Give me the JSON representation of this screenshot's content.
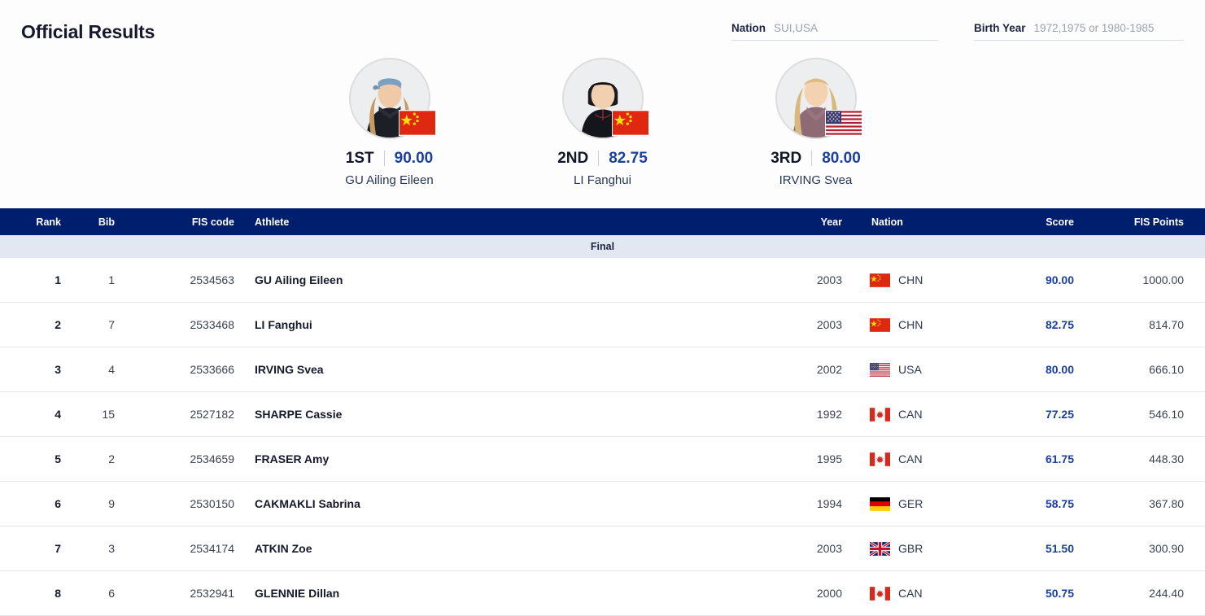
{
  "header": {
    "title": "Official Results",
    "filters": [
      {
        "name": "nation",
        "label": "Nation",
        "value": "",
        "placeholder": "SUI,USA"
      },
      {
        "name": "birth-year",
        "label": "Birth Year",
        "value": "",
        "placeholder": "1972,1975 or 1980-1985"
      }
    ]
  },
  "podium": [
    {
      "rank_label": "1ST",
      "score": "90.00",
      "name": "GU Ailing Eileen",
      "flag": "CHN",
      "avatar": "female-cap-blond"
    },
    {
      "rank_label": "2ND",
      "score": "82.75",
      "name": "LI Fanghui",
      "flag": "CHN",
      "avatar": "female-dark-hair"
    },
    {
      "rank_label": "3RD",
      "score": "80.00",
      "name": "IRVING Svea",
      "flag": "USA",
      "avatar": "female-blond-jacket"
    }
  ],
  "table": {
    "columns": [
      "Rank",
      "Bib",
      "FIS code",
      "Athlete",
      "Year",
      "Nation",
      "Score",
      "FIS Points"
    ],
    "section_label": "Final",
    "rows": [
      {
        "rank": "1",
        "bib": "1",
        "fis_code": "2534563",
        "athlete": "GU Ailing Eileen",
        "year": "2003",
        "nation": "CHN",
        "score": "90.00",
        "fis_points": "1000.00"
      },
      {
        "rank": "2",
        "bib": "7",
        "fis_code": "2533468",
        "athlete": "LI Fanghui",
        "year": "2003",
        "nation": "CHN",
        "score": "82.75",
        "fis_points": "814.70"
      },
      {
        "rank": "3",
        "bib": "4",
        "fis_code": "2533666",
        "athlete": "IRVING Svea",
        "year": "2002",
        "nation": "USA",
        "score": "80.00",
        "fis_points": "666.10"
      },
      {
        "rank": "4",
        "bib": "15",
        "fis_code": "2527182",
        "athlete": "SHARPE Cassie",
        "year": "1992",
        "nation": "CAN",
        "score": "77.25",
        "fis_points": "546.10"
      },
      {
        "rank": "5",
        "bib": "2",
        "fis_code": "2534659",
        "athlete": "FRASER Amy",
        "year": "1995",
        "nation": "CAN",
        "score": "61.75",
        "fis_points": "448.30"
      },
      {
        "rank": "6",
        "bib": "9",
        "fis_code": "2530150",
        "athlete": "CAKMAKLI Sabrina",
        "year": "1994",
        "nation": "GER",
        "score": "58.75",
        "fis_points": "367.80"
      },
      {
        "rank": "7",
        "bib": "3",
        "fis_code": "2534174",
        "athlete": "ATKIN Zoe",
        "year": "2003",
        "nation": "GBR",
        "score": "51.50",
        "fis_points": "300.90"
      },
      {
        "rank": "8",
        "bib": "6",
        "fis_code": "2532941",
        "athlete": "GLENNIE Dillan",
        "year": "2000",
        "nation": "CAN",
        "score": "50.75",
        "fis_points": "244.40"
      }
    ]
  },
  "colors": {
    "header_navy": "#001E6E",
    "section_band": "#E3E7F1",
    "score_blue": "#1B3F9E",
    "page_bg": "#FDFDFD"
  }
}
